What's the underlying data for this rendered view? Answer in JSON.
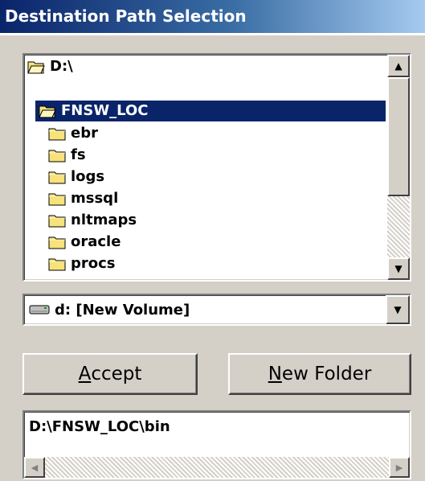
{
  "window": {
    "title": "Destination Path Selection"
  },
  "tree": {
    "root": "D:\\",
    "selected": "FNSW_LOC",
    "folders": [
      "ebr",
      "fs",
      "logs",
      "mssql",
      "nltmaps",
      "oracle",
      "procs"
    ]
  },
  "drive": {
    "selected": "d: [New Volume]"
  },
  "buttons": {
    "accept_mnemonic": "A",
    "accept_rest": "ccept",
    "newfolder_mnemonic": "N",
    "newfolder_rest": "ew Folder"
  },
  "path": {
    "value": "D:\\FNSW_LOC\\bin"
  },
  "colors": {
    "selection": "#0a246a",
    "face": "#d4d0c8",
    "folder": "#f7e27b"
  },
  "icons": {
    "folder": "folder-icon",
    "open_folder": "open-folder-icon",
    "drive": "drive-icon"
  }
}
